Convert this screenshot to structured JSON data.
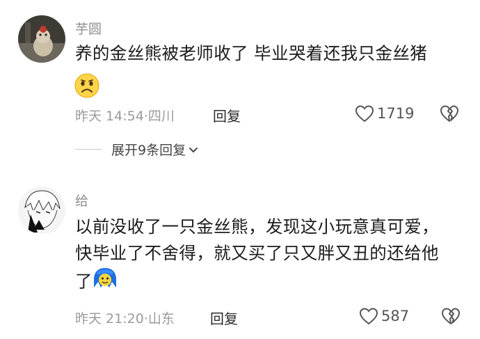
{
  "comments": [
    {
      "username": "芋圆",
      "text": "养的金丝熊被老师收了 毕业哭着还我只金丝猪",
      "time": "昨天 14:54",
      "location": "四川",
      "reply_label": "回复",
      "likes": "1719",
      "emoji": "sad-face-emoji",
      "expand_replies": "展开9条回复"
    },
    {
      "username": "给",
      "text_lines": [
        "以前没收了一只金丝熊，发现这小玩意真可爱，",
        "快毕业了不舍得，就又买了只又胖又丑的还给他",
        "了"
      ],
      "time": "昨天 21:20",
      "location": "山东",
      "reply_label": "回复",
      "likes": "587",
      "emoji": "blue-haired-face-emoji"
    }
  ],
  "icons": {
    "like": "heart-outline-icon",
    "dislike": "broken-heart-icon",
    "expand": "chevron-down-icon"
  },
  "colors": {
    "text": "#1b1b1b",
    "meta": "#9a9a9a",
    "username": "#8f8f8f"
  }
}
